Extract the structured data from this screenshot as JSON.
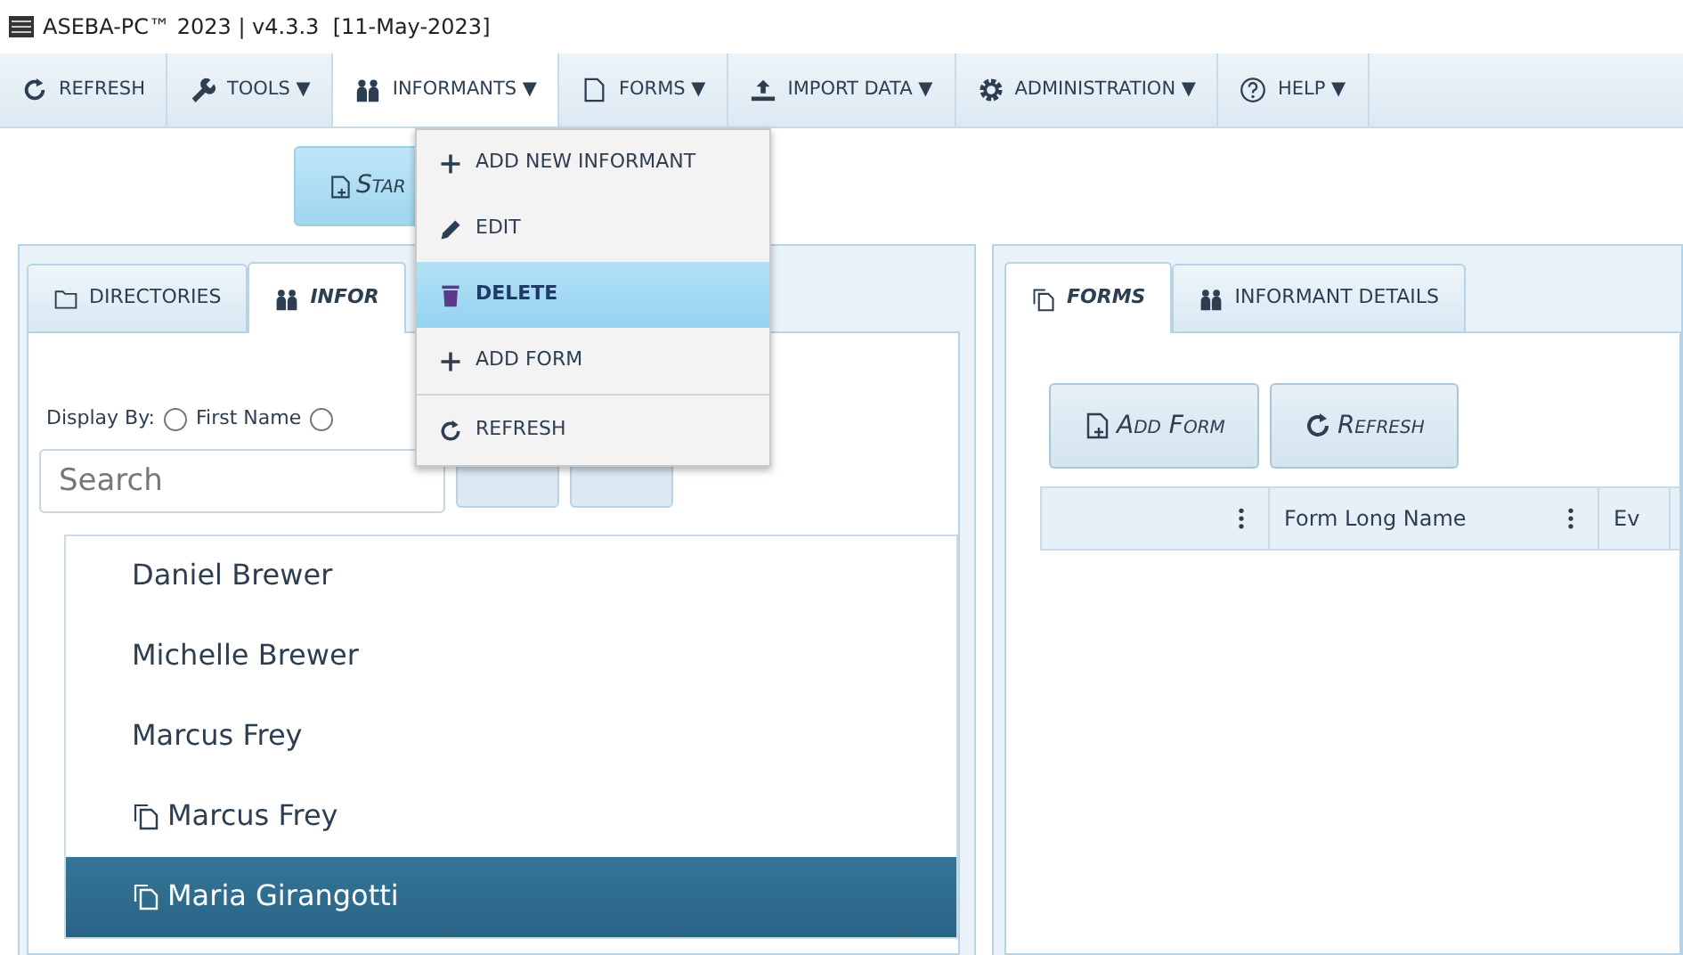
{
  "window": {
    "title": "ASEBA-PC™ 2023 | v4.3.3  [11-May-2023]"
  },
  "toolbar": [
    {
      "label": "REFRESH",
      "kind": "refresh",
      "open": false
    },
    {
      "label": "TOOLS",
      "kind": "wrench",
      "caret": "▼",
      "open": false
    },
    {
      "label": "INFORMANTS",
      "kind": "people",
      "caret": "▼",
      "open": true
    },
    {
      "label": "FORMS",
      "kind": "document",
      "caret": "▼",
      "open": false
    },
    {
      "label": "IMPORT DATA",
      "kind": "upload",
      "caret": "▼",
      "open": false
    },
    {
      "label": "ADMINISTRATION",
      "kind": "gear",
      "caret": "▼",
      "open": false
    },
    {
      "label": "HELP",
      "kind": "question",
      "caret": "▼",
      "open": false
    }
  ],
  "informants_menu": [
    {
      "label": "ADD NEW INFORMANT",
      "kind": "plus",
      "selected": false,
      "divider_before": false
    },
    {
      "label": "EDIT",
      "kind": "pencil",
      "selected": false,
      "divider_before": false
    },
    {
      "label": "DELETE",
      "kind": "trash",
      "selected": true,
      "divider_before": false
    },
    {
      "label": "ADD FORM",
      "kind": "plus",
      "selected": false,
      "divider_before": false
    },
    {
      "label": "REFRESH",
      "kind": "refresh",
      "selected": false,
      "divider_before": true
    }
  ],
  "start_button": {
    "label": "Star"
  },
  "left_panel": {
    "tabs": [
      {
        "label": "DIRECTORIES",
        "kind": "folder",
        "selected": false
      },
      {
        "label": "INFOR",
        "kind": "people",
        "selected": true
      }
    ],
    "display_by": {
      "label": "Display By:",
      "options": [
        {
          "label": "First Name",
          "selected": false
        },
        {
          "selected": false
        }
      ]
    },
    "search": {
      "placeholder": "Search"
    },
    "informants": [
      {
        "name": "Daniel Brewer",
        "has_forms": false,
        "selected": false
      },
      {
        "name": "Michelle Brewer",
        "has_forms": false,
        "selected": false
      },
      {
        "name": "Marcus Frey",
        "has_forms": false,
        "selected": false
      },
      {
        "name": "Marcus Frey",
        "has_forms": true,
        "selected": false
      },
      {
        "name": "Maria Girangotti",
        "has_forms": true,
        "selected": true
      }
    ]
  },
  "right_panel": {
    "tabs": [
      {
        "label": "FORMS",
        "kind": "copy",
        "selected": true
      },
      {
        "label": "INFORMANT DETAILS",
        "kind": "people",
        "selected": false
      }
    ],
    "buttons": [
      {
        "label": "Add Form",
        "kind": "newdoc"
      },
      {
        "label": "Refresh",
        "kind": "refresh"
      }
    ],
    "table": {
      "columns": [
        {
          "kind": "blank"
        },
        {
          "kind": "text",
          "label": "Form Long Name"
        },
        {
          "kind": "text",
          "label": "Ev"
        }
      ]
    }
  }
}
